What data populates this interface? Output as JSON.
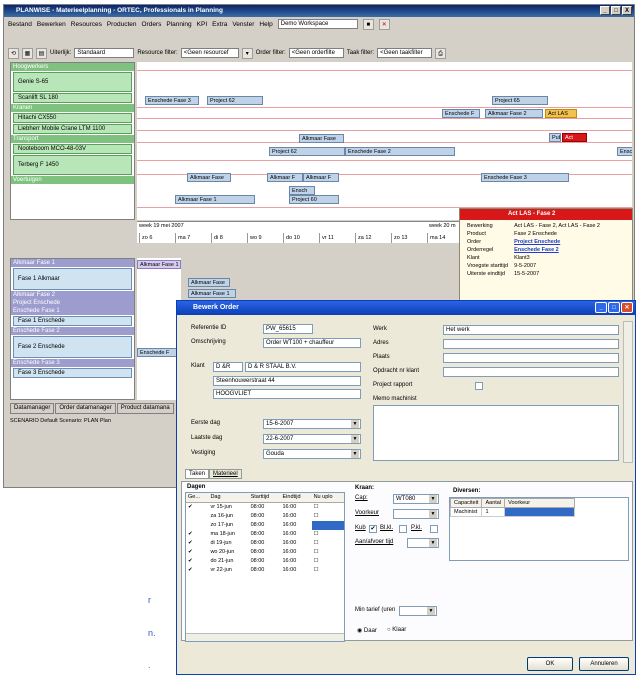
{
  "window": {
    "title": "PLANWISE - Materieelplanning - ORTEC, Professionals in Planning",
    "controls": [
      "_",
      "□",
      "X"
    ]
  },
  "menu": [
    "Bestand",
    "Bewerken",
    "Resources",
    "Producten",
    "Orders",
    "Planning",
    "KPI",
    "Extra",
    "Venster",
    "Help"
  ],
  "menu_workspace": "Demo Workspace",
  "toolbar": {
    "uiterlijk_label": "Uiterlijk:",
    "uiterlijk_value": "Standaard",
    "resource_filter_label": "Resource filter:",
    "resource_filter_value": "<Geen resourcef",
    "order_filter_label": "Order filter:",
    "order_filter_value": "<Geen orderfilte",
    "taak_filter_label": "Taak filter:",
    "taak_filter_value": "<Geen taakfilter"
  },
  "resources": [
    {
      "group": "Hoogwerkers",
      "items": [
        "Genie S-65",
        "Scanlift SL 180"
      ]
    },
    {
      "group": "Kranen",
      "items": [
        "Hitachi CX550",
        "Liebherr Mobile Crane LTM 1100"
      ]
    },
    {
      "group": "Transport",
      "items": [
        "Nooteboom MCO-48-03V",
        "Terberg F 1450"
      ]
    },
    {
      "group": "Voertuigen",
      "items": []
    }
  ],
  "gantt_bars": {
    "r1": [
      "Enschede Fase 3",
      "Project 62",
      "Project 65"
    ],
    "r2": [
      "Enschede F",
      "Alkmaar Fase 2",
      "Act LAS"
    ],
    "r3": [
      "Pub",
      "Act"
    ],
    "r4": [
      "Alkmaar Fase",
      "Project 62",
      "Enschede Fase 2",
      "Ensc"
    ],
    "r5": [
      "Alkmaar Fase",
      "Alkmaar F",
      "Alkmaar F",
      "Enschede Fase 3"
    ],
    "r6": [
      "Ensch",
      "Alkmaar Fase 1",
      "Project 60"
    ]
  },
  "dates": {
    "week1": "week 19 mei 2007",
    "week2": "week 20 m",
    "days": [
      "zo 6",
      "ma 7",
      "di 8",
      "wo 9",
      "do 10",
      "vr 11",
      "za 12",
      "zo 13",
      "ma 14"
    ]
  },
  "projects": [
    {
      "group": "Alkmaar Fase 1",
      "items": [
        "Fase 1 Alkmaar"
      ]
    },
    {
      "group": "Alkmaar Fase 2",
      "items": []
    },
    {
      "group": "Project Enschede",
      "items": []
    },
    {
      "group": "Enschede Fase 1",
      "items": [
        "Fase 1 Enschede"
      ]
    },
    {
      "group": "Enschede Fase 2",
      "items": [
        "Fase 2 Enschede"
      ]
    },
    {
      "group": "Enschede Fase 3",
      "items": [
        "Fase 3 Enschede"
      ]
    }
  ],
  "project_bars": [
    "Alkmaar Fase 1",
    "Alkmaar Fase",
    "Alkmaar Fase 1",
    "Enschede F"
  ],
  "bottom_tabs": [
    "Datamanager",
    "Order datamanager",
    "Product datamana"
  ],
  "status": "SCENARIO Default Scenario: PLAN Plan",
  "popup": {
    "header": "Act LAS - Fase 2",
    "rows": [
      {
        "k": "Bewerking",
        "v": "Act LAS - Fase 2, Act LAS - Fase 2"
      },
      {
        "k": "Product",
        "v": "Fase 2 Enschede"
      },
      {
        "k": "Order",
        "v": "Project Enschede"
      },
      {
        "k": "Orderregel",
        "v": "Enschede Fase 2"
      },
      {
        "k": "Klant",
        "v": "Klant3"
      },
      {
        "k": "Vroegste starttijd",
        "v": "9-5-2007"
      },
      {
        "k": "Uiterste eindtijd",
        "v": "15-5-2007"
      }
    ]
  },
  "dialog": {
    "title": "Bewerk Order",
    "referentie_label": "Referentie ID",
    "referentie_value": "PW_65615",
    "omschrijving_label": "Omschrijving",
    "omschrijving_value": "Order WT100 + chauffeur",
    "klant_label": "Klant",
    "klant_code": "D &R",
    "klant_name": "D & R STAAL B.V.",
    "adres1": "Steenhouwerstraat 44",
    "adres2": "HOOGVLIET",
    "eerste_dag_label": "Eerste dag",
    "eerste_dag_value": "15-6-2007",
    "laatste_dag_label": "Laatste dag",
    "laatste_dag_value": "22-6-2007",
    "vestiging_label": "Vestiging",
    "vestiging_value": "Gouda",
    "werk_label": "Werk",
    "werk_value": "Het werk",
    "adres_label": "Adres",
    "plaats_label": "Plaats",
    "opdracht_label": "Opdracht nr klant",
    "project_rapport_label": "Project rapport",
    "memo_label": "Memo machinist",
    "tabs": [
      "Taken",
      "Materieel"
    ],
    "dagen_label": "Dagen",
    "days_headers": [
      "Ge...",
      "Dag",
      "Starttijd",
      "Eindtijd",
      "Nu uplo"
    ],
    "days_rows": [
      {
        "chk": "✔",
        "dag": "vr 15-jun",
        "start": "08:00",
        "eind": "16:00"
      },
      {
        "chk": "",
        "dag": "za 16-jun",
        "start": "08:00",
        "eind": "16:00"
      },
      {
        "chk": "",
        "dag": "zo 17-jun",
        "start": "08:00",
        "eind": "16:00"
      },
      {
        "chk": "✔",
        "dag": "ma 18-jun",
        "start": "08:00",
        "eind": "16:00"
      },
      {
        "chk": "✔",
        "dag": "di 19-jun",
        "start": "08:00",
        "eind": "16:00"
      },
      {
        "chk": "✔",
        "dag": "wo 20-jun",
        "start": "08:00",
        "eind": "16:00"
      },
      {
        "chk": "✔",
        "dag": "do 21-jun",
        "start": "08:00",
        "eind": "16:00"
      },
      {
        "chk": "✔",
        "dag": "vr 22-jun",
        "start": "08:00",
        "eind": "16:00"
      }
    ],
    "kraan_label": "Kraan:",
    "cap_label": "Cap:",
    "cap_value": "WT080",
    "voorkeur_label": "Voorkeur",
    "kub_label": "Kub",
    "bl_label": "Bl.kl.",
    "pkl_label": "P.kl.",
    "aanafvoer_label": "Aan/afvoer tijd",
    "diversen_label": "Diversen:",
    "div_headers": [
      "Capaciteit",
      "Aantal",
      "Voorkeur"
    ],
    "div_row": {
      "cap": "Machinist",
      "aantal": "1",
      "voorkeur": ""
    },
    "min_tarief_label": "Min tarief (uren",
    "daar_label": "Daar",
    "klaar_label": "Klaar",
    "ok_label": "OK",
    "annuleren_label": "Annuleren"
  },
  "background_fragments": [
    "r",
    "n.",
    "."
  ]
}
